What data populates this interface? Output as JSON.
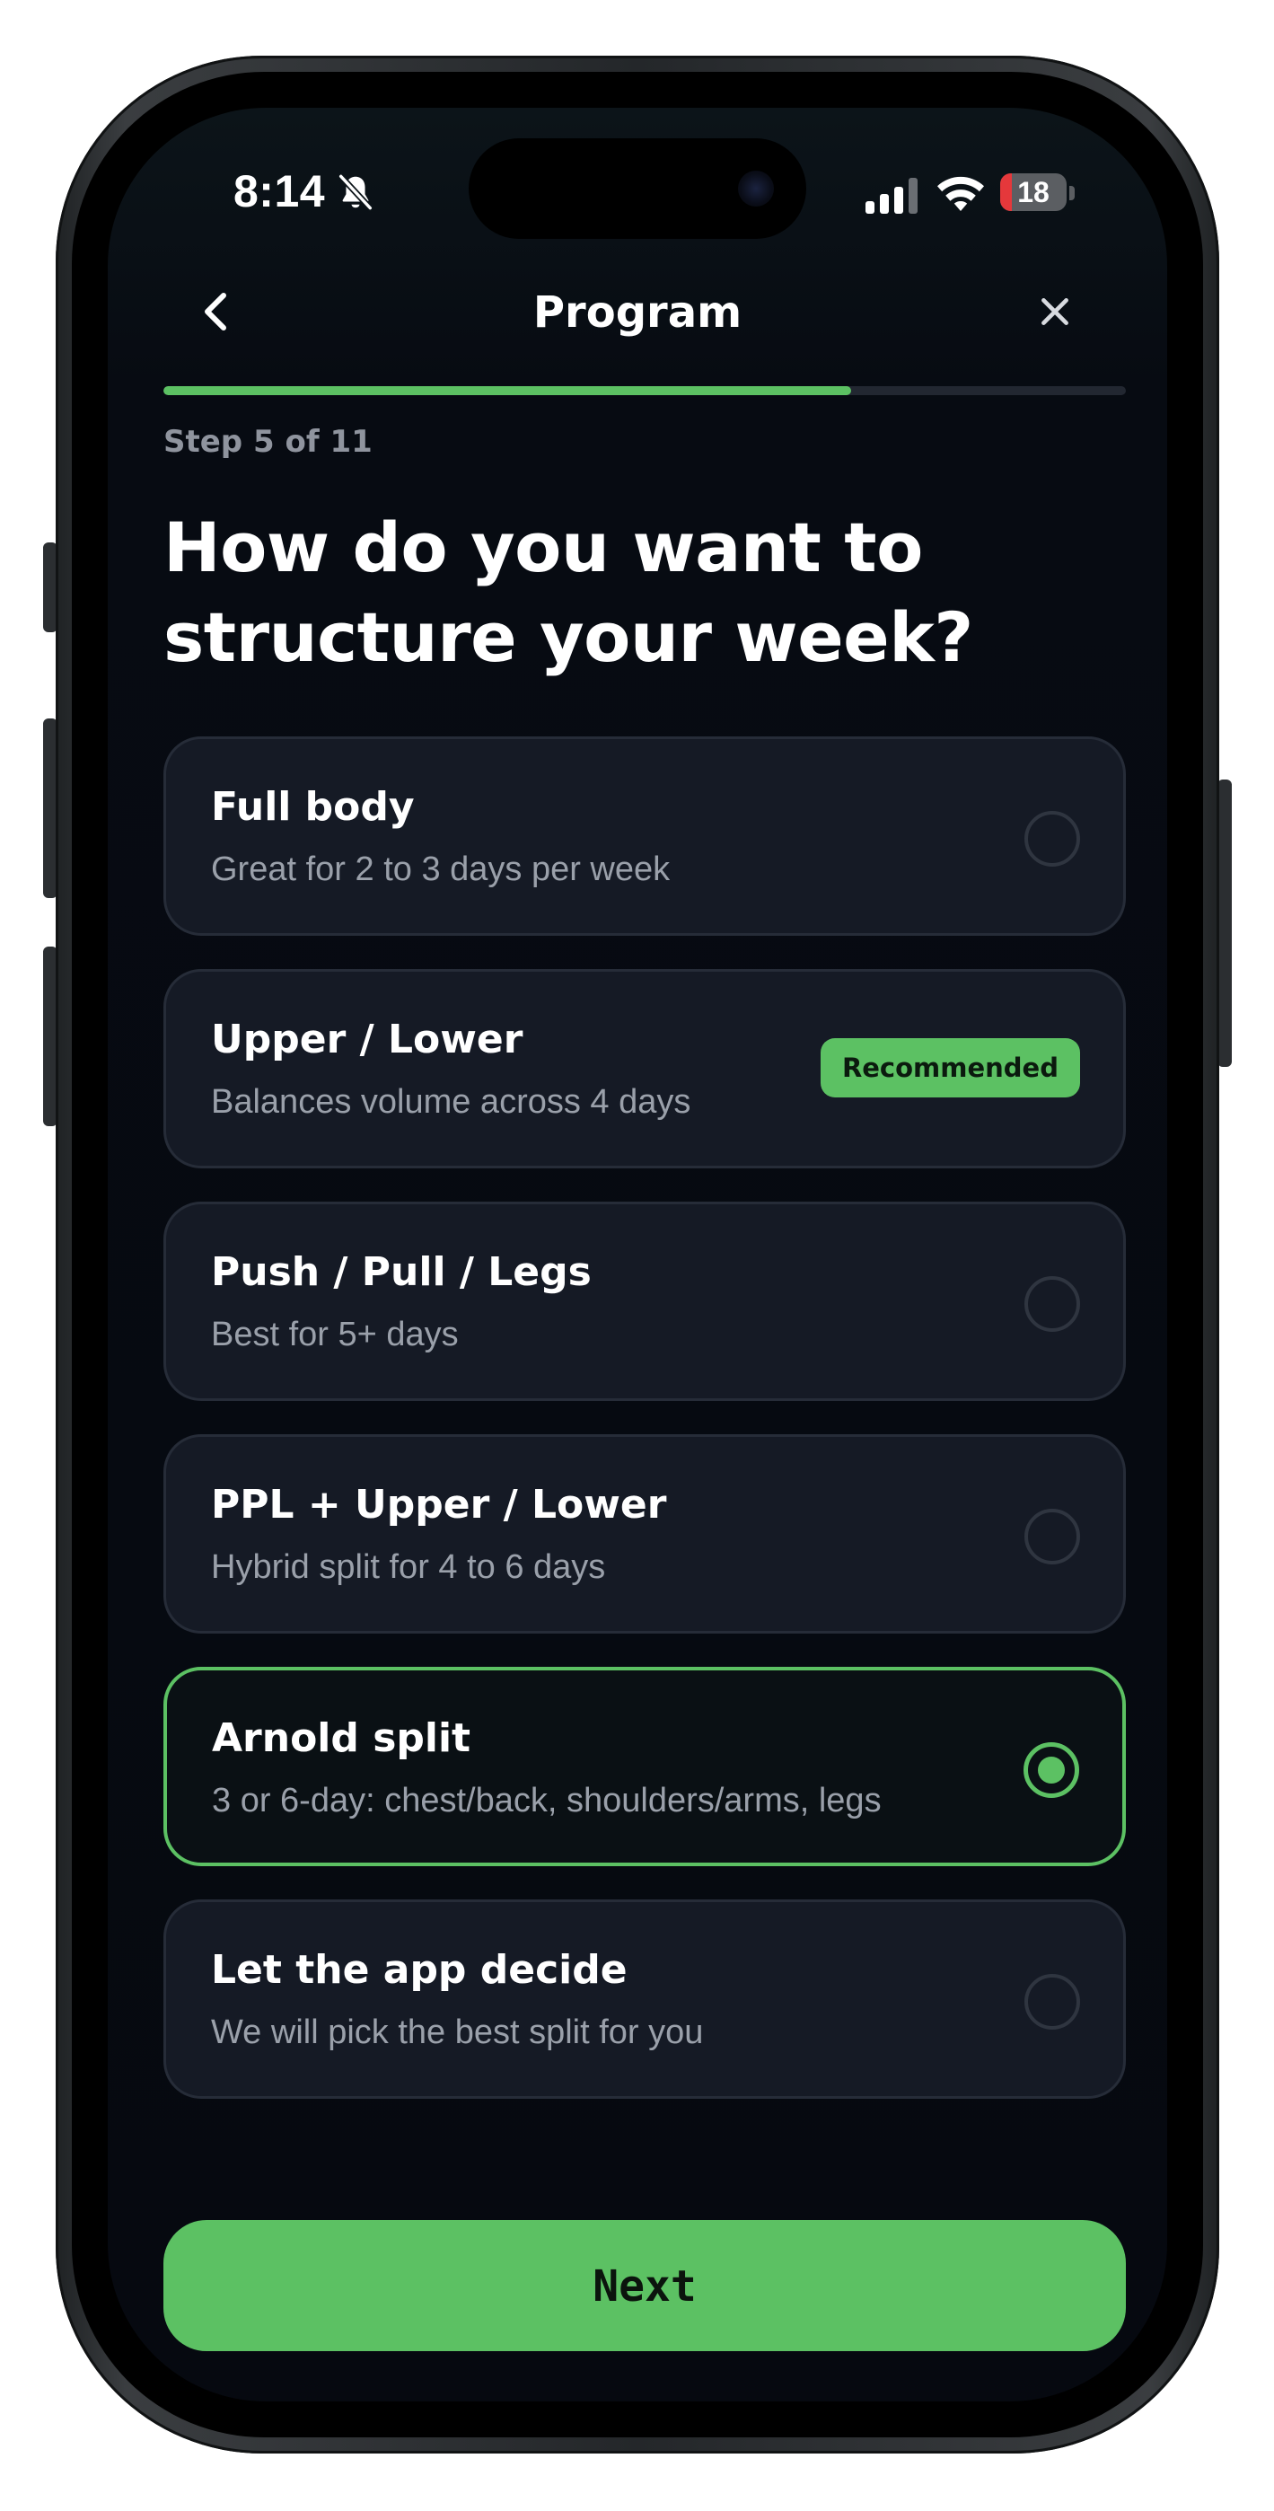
{
  "status_bar": {
    "time": "8:14",
    "battery_level": "18",
    "battery_fraction": 0.18
  },
  "header": {
    "title": "Program",
    "back_icon": "chevron-left-icon",
    "close_icon": "close-icon"
  },
  "progress": {
    "current_step": 5,
    "total_steps": 11,
    "fill_fraction": 0.7143,
    "label": "Step 5 of 11"
  },
  "question": "How do you want to structure your week?",
  "options": [
    {
      "title": "Full body",
      "subtitle": "Great for 2 to 3 days per week",
      "selected": false
    },
    {
      "title": "Upper / Lower",
      "subtitle": "Balances volume across 4 days",
      "selected": false,
      "badge": "Recommended"
    },
    {
      "title": "Push / Pull / Legs",
      "subtitle": "Best for 5+ days",
      "selected": false
    },
    {
      "title": "PPL + Upper / Lower",
      "subtitle": "Hybrid split for 4 to 6 days",
      "selected": false
    },
    {
      "title": "Arnold split",
      "subtitle": "3 or 6-day: chest/back, shoulders/arms, legs",
      "selected": true
    },
    {
      "title": "Let the app decide",
      "subtitle": "We will pick the best split for you",
      "selected": false
    }
  ],
  "next_button": {
    "label": "Next"
  },
  "colors": {
    "accent": "#5cc163",
    "background": "#060910",
    "card": "#151a25",
    "card_border": "#262c38",
    "muted_text": "#9aa0aa"
  }
}
